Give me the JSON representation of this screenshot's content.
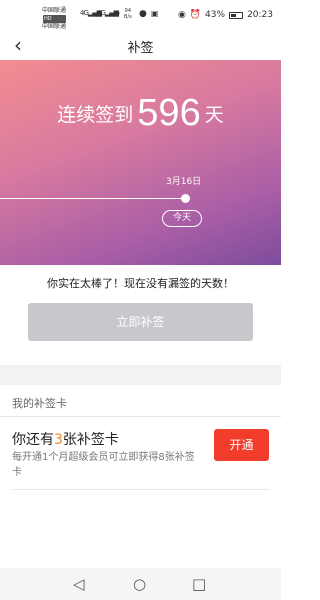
{
  "status_bar": {
    "carrier1": "中国联通",
    "carrier2": "中国联通",
    "hd": "HD",
    "net1": "4G",
    "net2": "4G",
    "speed_value": "94",
    "speed_unit": "B/s",
    "battery_pct": "43%",
    "time": "20:23"
  },
  "nav": {
    "back_icon": "chevron-left-icon",
    "title": "补签"
  },
  "hero": {
    "prefix": "连续签到",
    "days": "596",
    "suffix": "天",
    "date": "3月16日",
    "today": "今天"
  },
  "message": "你实在太棒了！现在没有漏签的天数！",
  "sign_button": "立即补签",
  "section": {
    "title": "我的补签卡"
  },
  "card": {
    "title_prefix": "你还有",
    "count": "3",
    "title_suffix": "张补签卡",
    "description": "每开通1个月超级会员可立即获得8张补签卡",
    "open_button": "开通"
  },
  "colors": {
    "accent_orange": "#f08a24",
    "open_button_red": "#f23c2c",
    "disabled_button": "#c8c8cc",
    "hero_gradient_start": "#f38d90",
    "hero_gradient_end": "#7d4c9d"
  }
}
